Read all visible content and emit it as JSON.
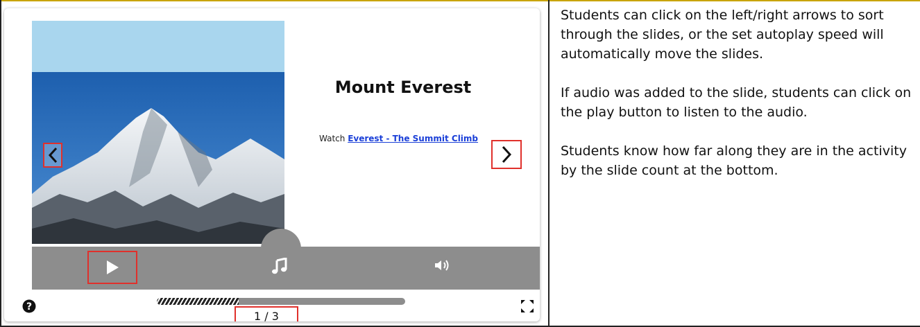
{
  "slide": {
    "title": "Mount Everest",
    "text_prefix": "Watch ",
    "link_text": "Everest - The Summit Climb"
  },
  "controls": {
    "prev_icon": "chevron-left-icon",
    "next_icon": "chevron-right-icon",
    "play_icon": "play-icon",
    "music_icon": "music-note-icon",
    "volume_icon": "volume-icon",
    "help_icon": "help-icon",
    "fullscreen_icon": "fullscreen-icon"
  },
  "progress": {
    "fraction": 0.33,
    "slide_count": "1 / 3"
  },
  "colors": {
    "highlight": "#e0302b",
    "link": "#1a3fd8",
    "control_bar": "#8d8d8d"
  },
  "description": {
    "paragraphs": [
      "Students can click on the left/right arrows to sort through the slides, or the set autoplay speed will automatically move the slides.",
      "If audio was added to the slide, students can click on the play button to listen to the audio.",
      "Students know how far along they are in the activity by the slide count at the bottom."
    ]
  }
}
